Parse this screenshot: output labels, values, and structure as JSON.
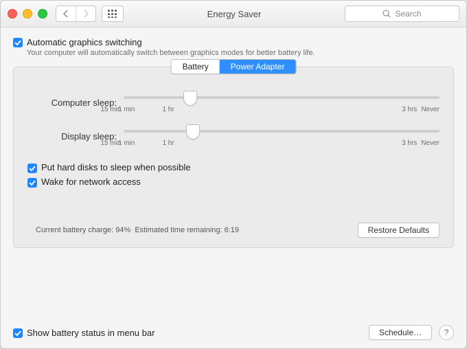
{
  "titlebar": {
    "title": "Energy Saver",
    "search_placeholder": "Search"
  },
  "auto_graphics": {
    "label": "Automatic graphics switching",
    "sub": "Your computer will automatically switch between graphics modes for better battery life.",
    "checked": true
  },
  "tabs": {
    "battery": "Battery",
    "power_adapter": "Power Adapter",
    "active": "power_adapter"
  },
  "sliders": {
    "computer": {
      "label": "Computer sleep:",
      "position_pct": 21
    },
    "display": {
      "label": "Display sleep:",
      "position_pct": 22
    },
    "ticks": [
      "1 min",
      "15 min",
      "1 hr",
      "3 hrs",
      "Never"
    ]
  },
  "options": {
    "hard_disks": {
      "label": "Put hard disks to sleep when possible",
      "checked": true
    },
    "wake_net": {
      "label": "Wake for network access",
      "checked": true
    }
  },
  "status": {
    "charge_label": "Current battery charge:",
    "charge_value": "94%",
    "remaining_label": "Estimated time remaining:",
    "remaining_value": "6:19"
  },
  "buttons": {
    "restore": "Restore Defaults",
    "schedule": "Schedule…"
  },
  "footer": {
    "show_battery": {
      "label": "Show battery status in menu bar",
      "checked": true
    }
  }
}
